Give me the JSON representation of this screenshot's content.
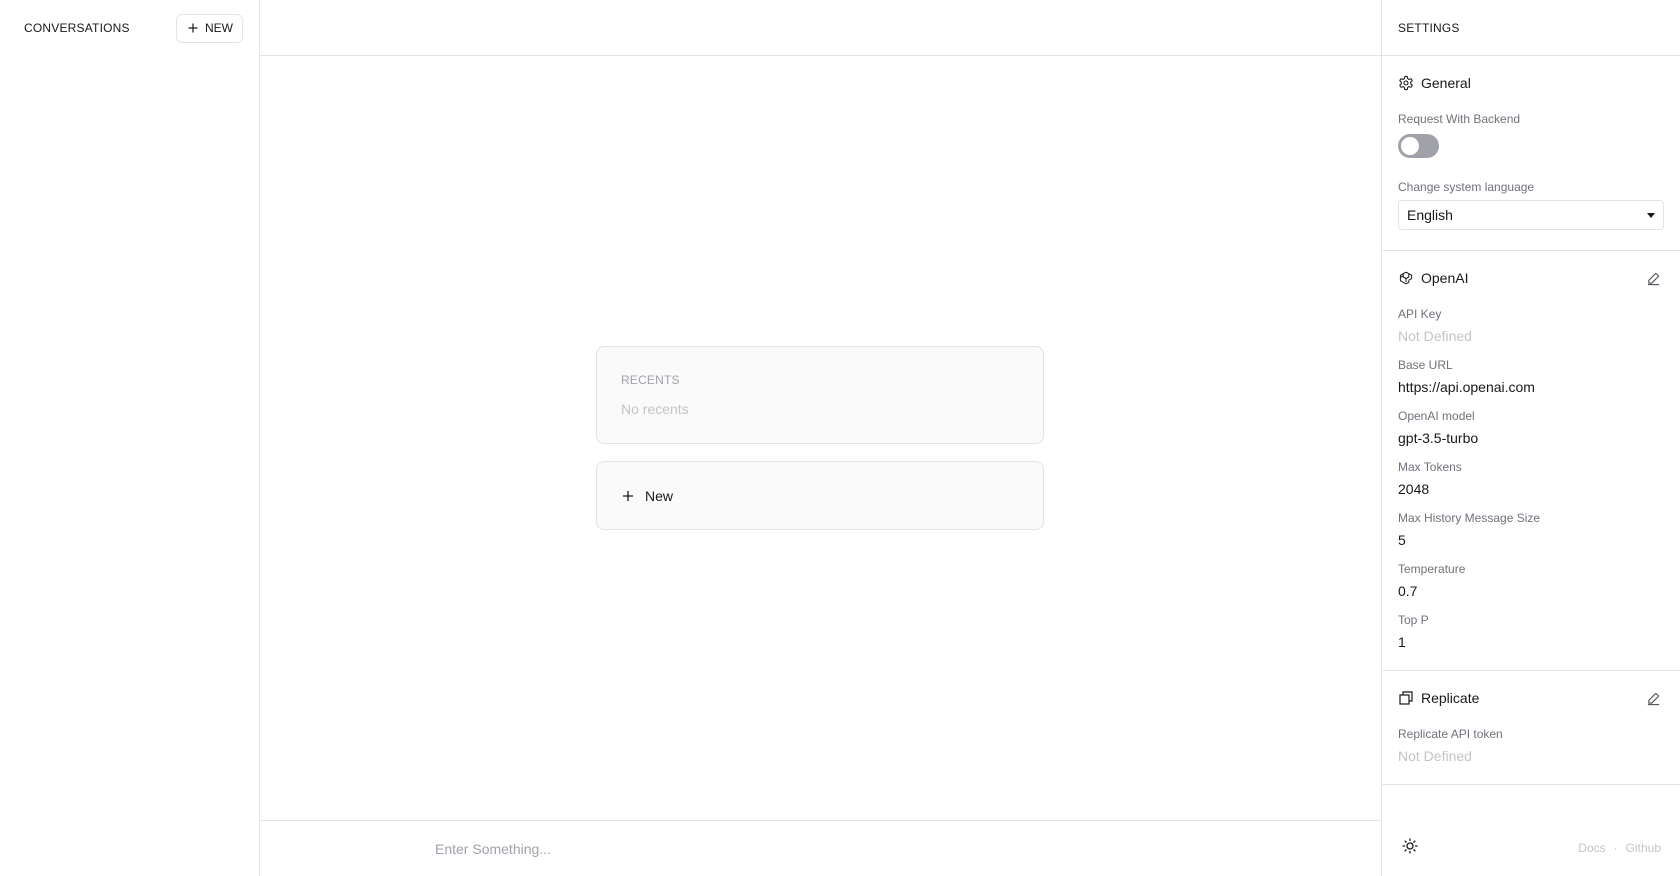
{
  "sidebar": {
    "title": "CONVERSATIONS",
    "new_label": "NEW"
  },
  "main": {
    "recents_label": "RECENTS",
    "recents_empty": "No recents",
    "new_label": "New",
    "input_placeholder": "Enter Something..."
  },
  "settings": {
    "title": "SETTINGS",
    "general": {
      "title": "General",
      "backend_label": "Request With Backend",
      "backend_enabled": false,
      "language_label": "Change system language",
      "language_value": "English"
    },
    "openai": {
      "title": "OpenAI",
      "fields": [
        {
          "label": "API Key",
          "value": "Not Defined"
        },
        {
          "label": "Base URL",
          "value": "https://api.openai.com"
        },
        {
          "label": "OpenAI model",
          "value": "gpt-3.5-turbo"
        },
        {
          "label": "Max Tokens",
          "value": "2048"
        },
        {
          "label": "Max History Message Size",
          "value": "5"
        },
        {
          "label": "Temperature",
          "value": "0.7"
        },
        {
          "label": "Top P",
          "value": "1"
        }
      ]
    },
    "replicate": {
      "title": "Replicate",
      "fields": [
        {
          "label": "Replicate API token",
          "value": "Not Defined"
        }
      ]
    },
    "footer": {
      "docs": "Docs",
      "separator": "·",
      "github": "Github"
    }
  },
  "icons": {
    "plus": "plus-icon",
    "gear": "gear-icon",
    "openai": "openai-icon",
    "replicate": "replicate-icon",
    "edit": "pencil-icon",
    "theme": "sun-icon"
  },
  "colors": {
    "border": "#e4e4e7",
    "muted_text": "#a1a1aa",
    "toggle_off": "#a1a1aa"
  }
}
